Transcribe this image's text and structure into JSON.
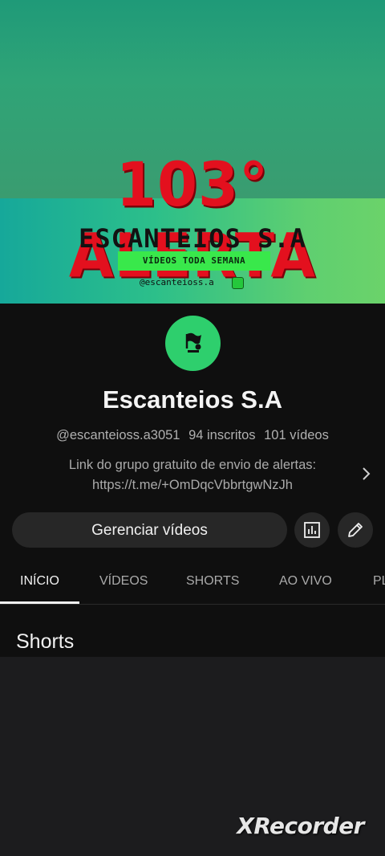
{
  "banner": {
    "title": "103° ALERTA",
    "brand": "ESCANTEIOS S.A",
    "tagline": "VÍDEOS TODA SEMANA",
    "handle": "@escanteioss.a"
  },
  "channel": {
    "name": "Escanteios S.A",
    "handle": "@escanteioss.a3051",
    "subscribers": "94 inscritos",
    "videos": "101 vídeos",
    "description_line1": "Link do grupo gratuito de envio de alertas:",
    "description_line2": "https://t.me/+OmDqcVbbrtgwNzJh"
  },
  "actions": {
    "manage_label": "Gerenciar vídeos",
    "analytics_icon": "analytics-icon",
    "edit_icon": "pencil-icon"
  },
  "tabs": [
    {
      "label": "INÍCIO",
      "active": true
    },
    {
      "label": "VÍDEOS",
      "active": false
    },
    {
      "label": "SHORTS",
      "active": false
    },
    {
      "label": "AO VIVO",
      "active": false
    },
    {
      "label": "PL",
      "active": false
    }
  ],
  "section": {
    "title": "Shorts"
  },
  "watermark": "XRecorder",
  "colors": {
    "background": "#0f0f0f",
    "avatar": "#2ecf6d",
    "banner_title": "#e3101e",
    "banner_pill": "#39e84b"
  }
}
